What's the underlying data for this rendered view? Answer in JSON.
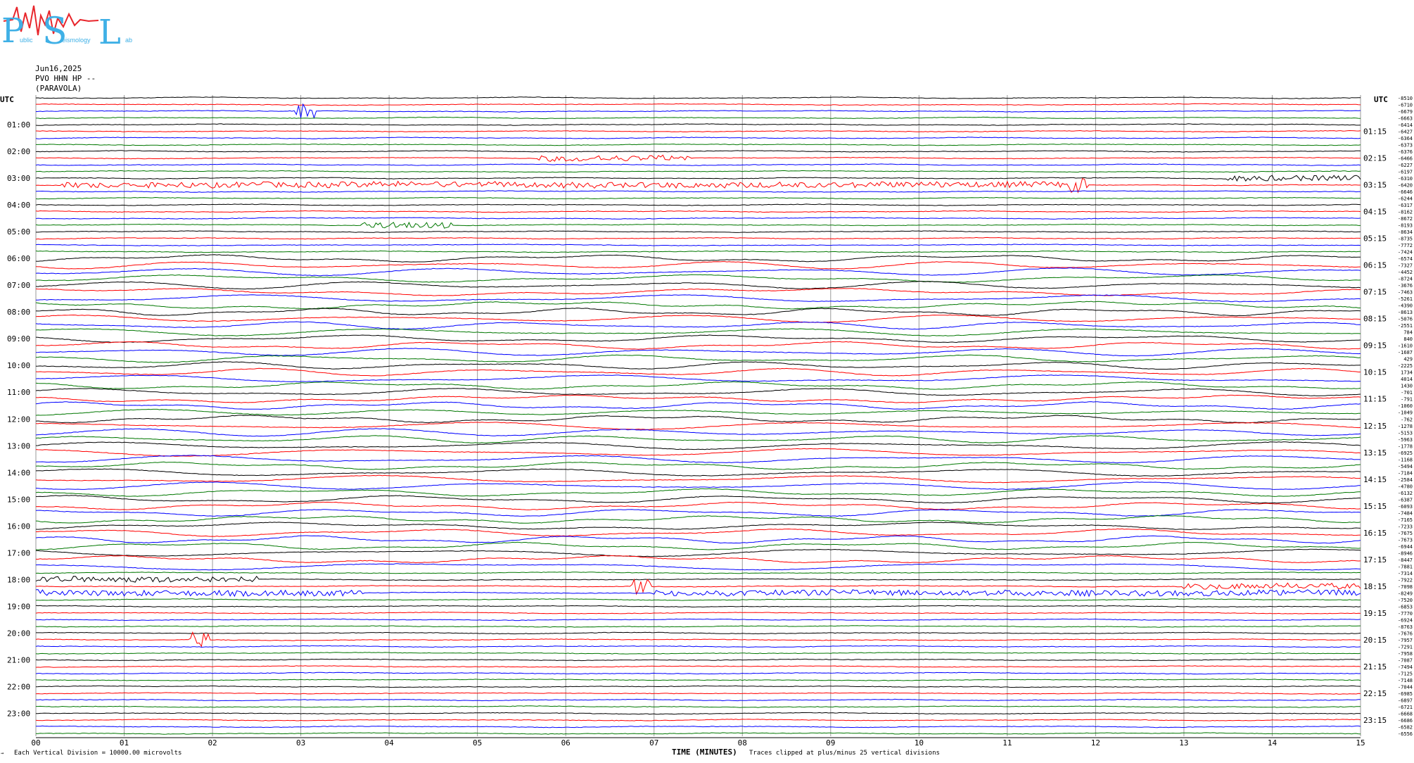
{
  "logo": {
    "letters": [
      "P",
      "S",
      "L"
    ],
    "small_words": [
      "ublic",
      "eismology",
      "ab"
    ],
    "colors": {
      "blue": "#3fb0e6",
      "red": "#e8262c"
    }
  },
  "header": {
    "date": "Jun16,2025",
    "station": "PVO HHN HP --",
    "site": "(PARAVOLA)"
  },
  "footer": {
    "vertical_division": "Each Vertical Division = 10000.00 microvolts",
    "xlabel": "TIME (MINUTES)",
    "clip_note": "Traces clipped at plus/minus 25 vertical divisions",
    "corner_mark": "→"
  },
  "chart_data": {
    "type": "line",
    "subtype": "helicorder",
    "left_axis_title": "UTC",
    "right_axis_title": "UTC",
    "x_ticks": [
      "00",
      "01",
      "02",
      "03",
      "04",
      "05",
      "06",
      "07",
      "08",
      "09",
      "10",
      "11",
      "12",
      "13",
      "14",
      "15"
    ],
    "xlim": [
      0,
      15
    ],
    "grid": "vertical lines every 1 minute",
    "left_hour_labels": [
      "01:00",
      "02:00",
      "03:00",
      "04:00",
      "05:00",
      "06:00",
      "07:00",
      "08:00",
      "09:00",
      "10:00",
      "11:00",
      "12:00",
      "13:00",
      "14:00",
      "15:00",
      "16:00",
      "17:00",
      "18:00",
      "19:00",
      "20:00",
      "21:00",
      "22:00",
      "23:00"
    ],
    "right_hour_labels": [
      "01:15",
      "02:15",
      "03:15",
      "04:15",
      "05:15",
      "06:15",
      "07:15",
      "08:15",
      "09:15",
      "10:15",
      "11:15",
      "12:15",
      "13:15",
      "14:15",
      "15:15",
      "16:15",
      "17:15",
      "18:15",
      "19:15",
      "20:15",
      "21:15",
      "22:15",
      "23:15"
    ],
    "trace_colors": [
      "#000000",
      "#ff0000",
      "#0000ff",
      "#007700"
    ],
    "trace_count": 96,
    "minutes_per_trace": 15,
    "trace_offsets": [
      -8510,
      -6710,
      -6679,
      -6663,
      -6414,
      -6427,
      -6364,
      -6373,
      -6376,
      -6466,
      -6227,
      -6197,
      -6310,
      -6420,
      -6646,
      -6244,
      -6317,
      -8162,
      -8672,
      -8193,
      -8634,
      -8735,
      -7772,
      -7424,
      -6574,
      -7327,
      -4452,
      -8724,
      -3676,
      -7463,
      -5261,
      -4390,
      -8613,
      -5076,
      -2551,
      784,
      840,
      -1610,
      -1687,
      429,
      -2225,
      1734,
      4014,
      1430,
      -701,
      -791,
      -1060,
      -1049,
      -762,
      -1278,
      -5153,
      -5963,
      -1778,
      -6925,
      -1168,
      -5494,
      -7184,
      -2584,
      -4780,
      -6132,
      -6387,
      -6093,
      -7484,
      -7165,
      -7233,
      -7675,
      -7673,
      -6944,
      -8946,
      -8447,
      -7881,
      -7314,
      -7922,
      -7098,
      -8249,
      -7520,
      -6853,
      -7770,
      -6924,
      -8763,
      -7676,
      -7957,
      -7291,
      -7958,
      -7087,
      -7494,
      -7125,
      -7148,
      -7044,
      -6985,
      -6897,
      -6721,
      -6668,
      -6686,
      -6582,
      -6556
    ],
    "events": [
      {
        "row": 2,
        "minute": 3.05,
        "color": "red",
        "note": "small burst"
      },
      {
        "row": 9,
        "minute_range": [
          5.7,
          7.4
        ],
        "color": "blue",
        "note": "ringing band"
      },
      {
        "row": 13,
        "minute_range": [
          0.3,
          11.9
        ],
        "color": "blue",
        "note": "high-amplitude noise"
      },
      {
        "row": 13,
        "minute": 11.8,
        "color": "blue",
        "note": "large spike"
      },
      {
        "row": 12,
        "minute_range": [
          13.5,
          15
        ],
        "color": "red",
        "note": "burst"
      },
      {
        "row": 19,
        "minute_range": [
          3.7,
          4.7
        ],
        "color": "green",
        "note": "oscillation"
      },
      {
        "row": 72,
        "minute_range": [
          0,
          2.5
        ],
        "color": "black",
        "note": "noise"
      },
      {
        "row": 74,
        "minute_range": [
          0,
          3.7
        ],
        "color": "green",
        "note": "noise"
      },
      {
        "row": 73,
        "minute_range": [
          13,
          15
        ],
        "color": "green",
        "note": "earthquake"
      },
      {
        "row": 73,
        "minute": 6.85,
        "color": "green",
        "note": "spike"
      },
      {
        "row": 74,
        "minute_range": [
          7,
          15
        ],
        "color": "blue",
        "note": "strong noise"
      },
      {
        "row": 81,
        "minute": 1.85,
        "color": "red",
        "note": "burst"
      }
    ]
  }
}
